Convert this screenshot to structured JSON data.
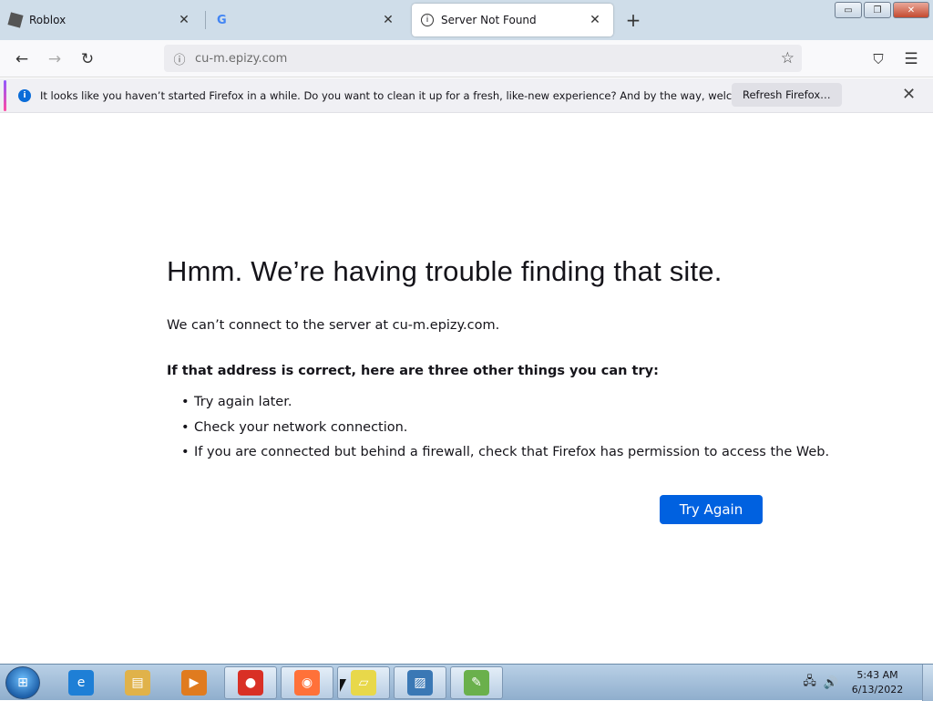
{
  "tabs": [
    {
      "title": "Roblox",
      "icon": "roblox-icon",
      "active": false
    },
    {
      "title": "",
      "icon": "google-icon",
      "active": false
    },
    {
      "title": "Server Not Found",
      "icon": "info-icon",
      "active": true
    }
  ],
  "window": {
    "min": "▭",
    "max": "❐",
    "close": "✕"
  },
  "navbar": {
    "back": "←",
    "forward": "→",
    "reload": "↻",
    "url_host": "cu-m.epizy.com",
    "star": "☆",
    "pocket": "⛉",
    "menu": "☰"
  },
  "notification": {
    "message": "It looks like you haven’t started Firefox in a while. Do you want to clean it up for a fresh, like-new experience? And by the way, welcome back!",
    "button": "Refresh Firefox…",
    "close": "✕"
  },
  "error": {
    "title": "Hmm. We’re having trouble finding that site.",
    "description": "We can’t connect to the server at cu-m.epizy.com.",
    "subtitle": "If that address is correct, here are three other things you can try:",
    "items": [
      "Try again later.",
      "Check your network connection.",
      "If you are connected but behind a firewall, check that Firefox has permission to access the Web."
    ],
    "button": "Try Again"
  },
  "taskbar": {
    "items": [
      {
        "name": "internet-explorer-icon",
        "glyph": "e",
        "color": "#1e7fd6",
        "running": false
      },
      {
        "name": "file-explorer-icon",
        "glyph": "▤",
        "color": "#e0b24a",
        "running": false
      },
      {
        "name": "media-player-icon",
        "glyph": "▶",
        "color": "#e07b1f",
        "running": false
      },
      {
        "name": "chrome-icon",
        "glyph": "●",
        "color": "#d93025",
        "running": true
      },
      {
        "name": "firefox-icon",
        "glyph": "◉",
        "color": "#ff7139",
        "running": true
      },
      {
        "name": "sticky-notes-icon",
        "glyph": "▱",
        "color": "#e8d84a",
        "running": true
      },
      {
        "name": "image-viewer-icon",
        "glyph": "▨",
        "color": "#3a78b5",
        "running": true
      },
      {
        "name": "notepad-plus-icon",
        "glyph": "✎",
        "color": "#6ab04c",
        "running": true
      }
    ],
    "tray": {
      "network": "🖧",
      "volume": "🔊"
    },
    "time": "5:43 AM",
    "date": "6/13/2022"
  }
}
